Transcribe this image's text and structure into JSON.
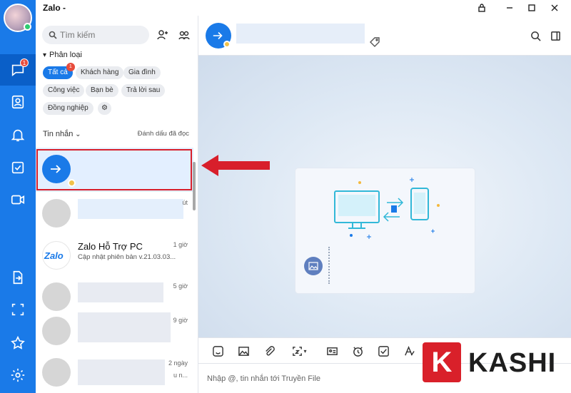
{
  "window": {
    "title": "Zalo -"
  },
  "nav": {
    "messages_badge": "1"
  },
  "panel": {
    "search_placeholder": "Tìm kiếm",
    "section_title": "Phân loại",
    "chips": [
      "Tất cả",
      "Khách hàng",
      "Gia đình",
      "Công việc",
      "Bạn bè",
      "Trả lời sau",
      "Đồng nghiệp"
    ],
    "chip_badge": "1",
    "list_header": "Tin nhắn",
    "mark_read": "Đánh dấu đã đọc"
  },
  "conversations": [
    {
      "name": "",
      "time": ""
    },
    {
      "name": "",
      "time": "út"
    },
    {
      "name": "Zalo Hỗ Trợ PC",
      "preview": "Cập nhật phiên bản v.21.03.03...",
      "time": "1 giờ",
      "avatar_text": "Zalo"
    },
    {
      "name": "",
      "time": "5 giờ"
    },
    {
      "name": "",
      "time": "9 giờ"
    },
    {
      "name": "",
      "time": "2 ngày",
      "time2": "u n..."
    }
  ],
  "composer": {
    "placeholder": "Nhập @, tin nhắn tới Truyền File"
  },
  "watermark": {
    "k": "K",
    "brand": "KASHI"
  },
  "colors": {
    "accent": "#1a7ae8",
    "highlight": "#d81f2b",
    "badge": "#e74c3c"
  }
}
